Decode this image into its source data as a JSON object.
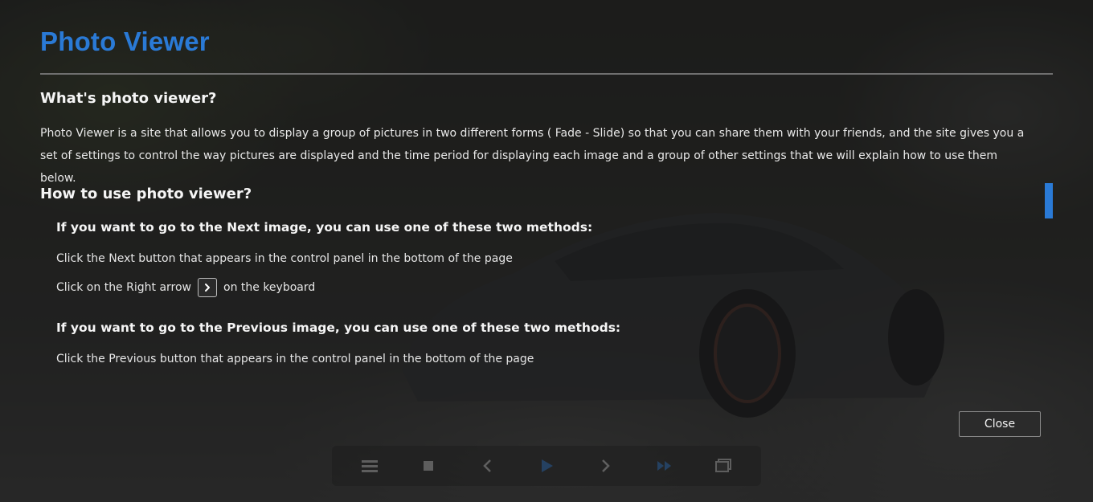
{
  "modal": {
    "title": "Photo Viewer",
    "sections": {
      "what": {
        "heading": "What's photo viewer?",
        "body": "Photo Viewer is a site that allows you to display a group of pictures in two different forms ( Fade - Slide) so that you can share them with your friends, and the site gives you a set of settings to control the way pictures are displayed and the time period for displaying each image and a group of other settings that we will explain how to use them below."
      },
      "how": {
        "heading": "How to use photo viewer?",
        "next": {
          "heading": "If you want to go to the Next image, you can use one of these two methods:",
          "method1": "Click the Next button that appears in the control panel in the bottom of the page",
          "method2_before": "Click on the Right arrow",
          "method2_key_icon": "chevron-right-icon",
          "method2_after": "on the keyboard"
        },
        "previous": {
          "heading": "If you want to go to the Previous image, you can use one of these two methods:",
          "method1": "Click the Previous button that appears in the control panel in the bottom of the page"
        }
      }
    },
    "close_label": "Close"
  },
  "control_panel": {
    "buttons": [
      {
        "icon": "menu-icon"
      },
      {
        "icon": "stop-icon"
      },
      {
        "icon": "previous-icon"
      },
      {
        "icon": "play-icon"
      },
      {
        "icon": "next-icon"
      },
      {
        "icon": "fast-forward-icon"
      },
      {
        "icon": "gallery-icon"
      }
    ]
  },
  "colors": {
    "accent": "#2a7ad6",
    "overlay": "#161616",
    "text": "#f2f2f2"
  }
}
